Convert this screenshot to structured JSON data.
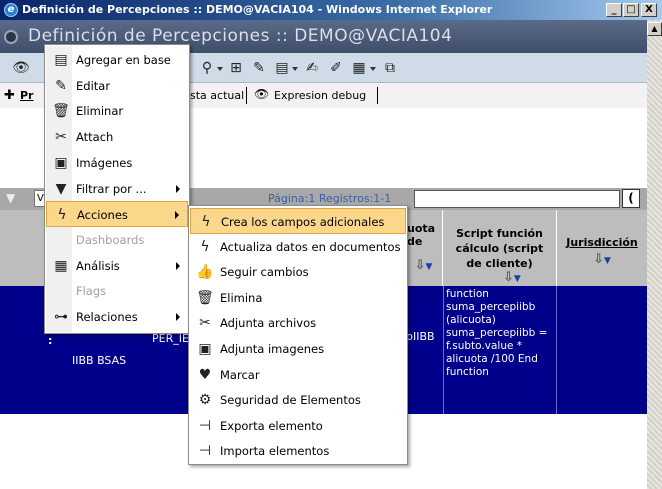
{
  "window": {
    "title": "Definición de Percepciones :: DEMO@VACIA104 - Windows Internet Explorer",
    "min": "_",
    "max": "□",
    "close": "X"
  },
  "page": {
    "header": "Definición de Percepciones :: DEMO@VACIA104"
  },
  "subbar": {
    "pr_label": "Pr",
    "vista_actual": "sta actual",
    "expresion_debug": "Expresion debug"
  },
  "filterbar": {
    "select_value": "V",
    "pagination": "Página:1 Registros:1-1",
    "search_button": "("
  },
  "table": {
    "headers": [
      {
        "label": "uota\nde",
        "col": "cuota"
      },
      {
        "label": "Script función cálculo (script de cliente)",
        "col": "script"
      },
      {
        "label": "Jurisdicción",
        "col": "jurisdiccion"
      }
    ],
    "row": {
      "marker": ":",
      "col_a": "IIBB BSAS",
      "col_b": "PER_IE",
      "col_c": "pIIBB",
      "script": "function suma_percepiibb (alicuota) suma_percepiibb = f.subto.value * alicuota /100 End function",
      "jurisdiccion": ""
    }
  },
  "context_menu": {
    "items": [
      {
        "label": "Agregar en base",
        "icon": "add-to-database-icon",
        "glyph": "▤",
        "disabled": false,
        "submenu": false
      },
      {
        "label": "Editar",
        "icon": "edit-icon",
        "glyph": "✎",
        "disabled": false,
        "submenu": false
      },
      {
        "label": "Eliminar",
        "icon": "trash-icon",
        "glyph": "🗑",
        "disabled": false,
        "submenu": false
      },
      {
        "label": "Attach",
        "icon": "paperclip-icon",
        "glyph": "✂",
        "disabled": false,
        "submenu": false
      },
      {
        "label": "Imágenes",
        "icon": "images-icon",
        "glyph": "▣",
        "disabled": false,
        "submenu": false
      },
      {
        "label": "Filtrar por ...",
        "icon": "filter-icon",
        "glyph": "▼",
        "disabled": false,
        "submenu": true
      },
      {
        "label": "Acciones",
        "icon": "lightning-icon",
        "glyph": "ϟ",
        "disabled": false,
        "submenu": true,
        "highlighted": true
      },
      {
        "label": "Dashboards",
        "icon": "",
        "glyph": "",
        "disabled": true,
        "submenu": false
      },
      {
        "label": "Análisis",
        "icon": "analysis-icon",
        "glyph": "▦",
        "disabled": false,
        "submenu": true
      },
      {
        "label": "Flags",
        "icon": "",
        "glyph": "",
        "disabled": true,
        "submenu": false
      },
      {
        "label": "Relaciones",
        "icon": "relations-icon",
        "glyph": "⊶",
        "disabled": false,
        "submenu": true
      }
    ]
  },
  "submenu": {
    "items": [
      {
        "label": "Crea los campos adicionales",
        "icon": "lightning-icon",
        "glyph": "ϟ",
        "highlighted": true
      },
      {
        "label": "Actualiza datos en documentos",
        "icon": "lightning-icon",
        "glyph": "ϟ"
      },
      {
        "label": "Seguir cambios",
        "icon": "thumbs-up-icon",
        "glyph": "👍"
      },
      {
        "label": "Elimina",
        "icon": "trash-icon",
        "glyph": "🗑"
      },
      {
        "label": "Adjunta archivos",
        "icon": "paperclip-icon",
        "glyph": "✂"
      },
      {
        "label": "Adjunta imagenes",
        "icon": "images-icon",
        "glyph": "▣"
      },
      {
        "label": "Marcar",
        "icon": "heart-icon",
        "glyph": "♥"
      },
      {
        "label": "Seguridad de Elementos",
        "icon": "security-icon",
        "glyph": "⚙"
      },
      {
        "label": "Exporta elemento",
        "icon": "export-icon",
        "glyph": "⊣"
      },
      {
        "label": "Importa elementos",
        "icon": "import-icon",
        "glyph": "⊣"
      }
    ]
  },
  "colors": {
    "row_selected": "#00008b",
    "menu_highlight": "#fbd78b"
  }
}
